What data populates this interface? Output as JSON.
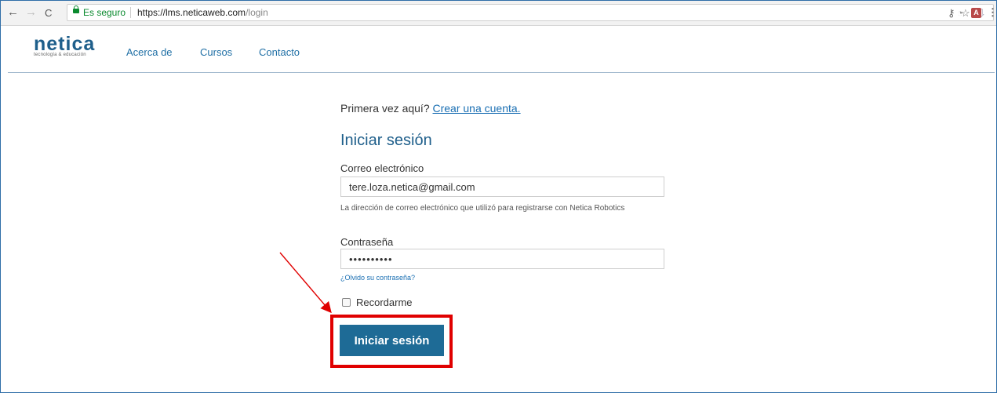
{
  "browser": {
    "back": "←",
    "forward": "→",
    "reload": "C",
    "secure_text": "Es seguro",
    "url_host": "https://lms.neticaweb.com",
    "url_path": "/login",
    "icons": [
      "key-icon",
      "star-icon",
      "extension-icon",
      "extension-icon",
      "pdf-icon",
      "menu-icon"
    ]
  },
  "site": {
    "logo_word": "netica",
    "logo_tagline": "tecnología & educación",
    "nav": [
      "Acerca de",
      "Cursos",
      "Contacto"
    ]
  },
  "form": {
    "first_time": "Primera vez aquí?",
    "create_account": "Crear una cuenta.",
    "title": "Iniciar sesión",
    "email_label": "Correo electrónico",
    "email_value": "tere.loza.netica@gmail.com",
    "email_help": "La dirección de correo electrónico que utilizó para registrarse con Netica Robotics",
    "password_label": "Contraseña",
    "password_value": "••••••••••",
    "forgot": "¿Olvido su contraseña?",
    "remember": "Recordarme",
    "submit": "Iniciar sesión"
  },
  "colors": {
    "brand": "#1f5f8b",
    "button": "#1e6b96",
    "annotation": "#e00000"
  }
}
